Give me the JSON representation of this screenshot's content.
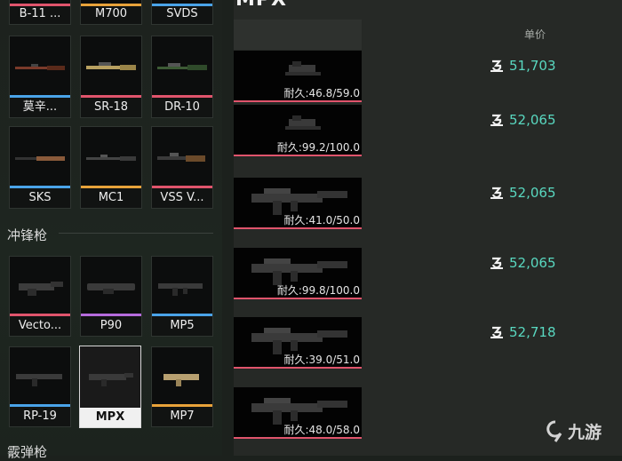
{
  "grid_top": [
    {
      "label": "B-11 ...",
      "bar": "#e0546c"
    },
    {
      "label": "M700",
      "bar": "#e8a23a"
    },
    {
      "label": "SVDS",
      "bar": "#4aa3e8"
    }
  ],
  "grid_snipers_1": [
    {
      "label": "莫辛...",
      "bar": "#4aa3e8",
      "icon": "mosin-rifle-icon"
    },
    {
      "label": "SR-18",
      "bar": "#e0546c",
      "icon": "sr18-rifle-icon"
    },
    {
      "label": "DR-10",
      "bar": "#e0546c",
      "icon": "dr10-rifle-icon"
    }
  ],
  "grid_snipers_2": [
    {
      "label": "SKS",
      "bar": "#4aa3e8",
      "icon": "sks-rifle-icon"
    },
    {
      "label": "MC1",
      "bar": "#e8a23a",
      "icon": "mc1-rifle-icon"
    },
    {
      "label": "VSS V...",
      "bar": "#e0546c",
      "icon": "vss-rifle-icon"
    }
  ],
  "smg_section": {
    "title": "冲锋枪"
  },
  "grid_smg_1": [
    {
      "label": "Vecto...",
      "bar": "#e0546c",
      "icon": "vector-smg-icon"
    },
    {
      "label": "P90",
      "bar": "#b56bdc",
      "icon": "p90-smg-icon"
    },
    {
      "label": "MP5",
      "bar": "#4aa3e8",
      "icon": "mp5-smg-icon"
    }
  ],
  "grid_smg_2": [
    {
      "label": "RP-19",
      "bar": "#4aa3e8",
      "icon": "rp19-smg-icon"
    },
    {
      "label": "MPX",
      "bar": "#d8d8d8",
      "icon": "mpx-smg-icon",
      "selected": true
    },
    {
      "label": "MP7",
      "bar": "#e8a23a",
      "icon": "mp7-smg-icon"
    }
  ],
  "next_section": {
    "title": "霰弹枪"
  },
  "listing": {
    "title": "MPX",
    "col_price": "单价",
    "rows": [
      {
        "durability": "耐久:46.8/59.0",
        "price": "51,703",
        "icon": "scope-part-icon"
      },
      {
        "durability": "耐久:99.2/100.0",
        "price": "52,065",
        "icon": "scope-part-icon"
      },
      {
        "durability": "耐久:41.0/50.0",
        "price": "52,065",
        "icon": "mpx-smg-icon"
      },
      {
        "durability": "耐久:99.8/100.0",
        "price": "52,065",
        "icon": "mpx-smg-icon"
      },
      {
        "durability": "耐久:39.0/51.0",
        "price": "52,718",
        "icon": "mpx-smg-icon"
      },
      {
        "durability": "耐久:48.0/58.0",
        "price": "",
        "icon": "mpx-smg-icon"
      }
    ]
  },
  "watermark": {
    "text": "九游"
  }
}
